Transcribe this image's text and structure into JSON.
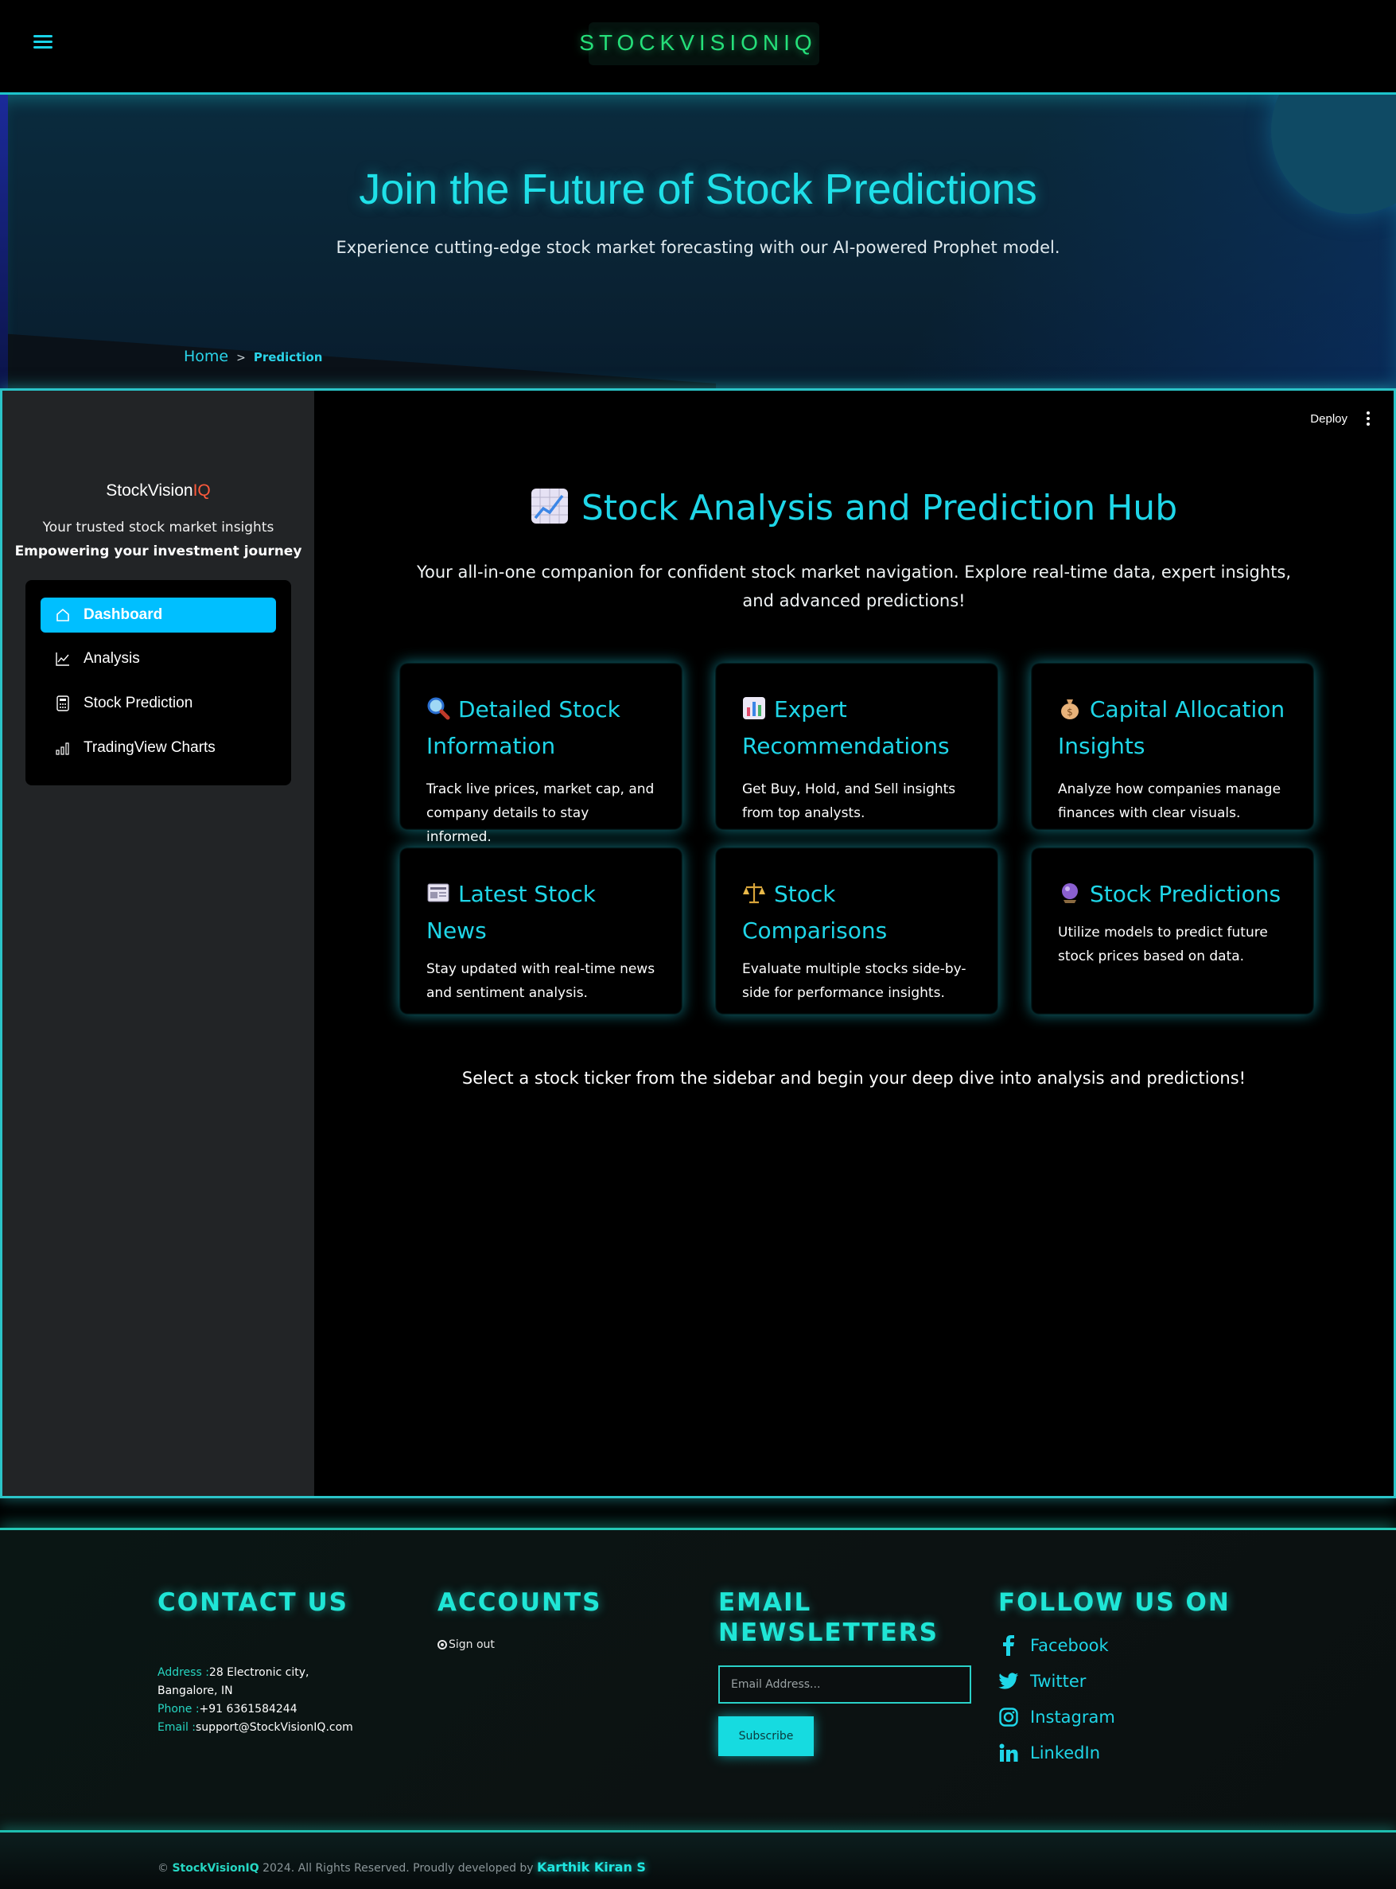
{
  "topbar": {
    "brand": "STOCKVISIONIQ"
  },
  "hero": {
    "title": "Join the Future of Stock Predictions",
    "subtitle": "Experience cutting-edge stock market forecasting with our AI-powered Prophet model.",
    "breadcrumb": {
      "home": "Home",
      "separator": ">",
      "current": "Prediction"
    }
  },
  "sidebar": {
    "brand_main": "StockVision",
    "brand_accent": "IQ",
    "tagline": "Your trusted stock market insights",
    "tagline_bold": "Empowering your investment journey",
    "items": [
      {
        "label": "Dashboard",
        "icon": "home-icon",
        "active": true
      },
      {
        "label": "Analysis",
        "icon": "line-chart-icon"
      },
      {
        "label": "Stock Prediction",
        "icon": "calculator-icon"
      },
      {
        "label": "TradingView Charts",
        "icon": "bar-signal-icon"
      }
    ]
  },
  "toolbar": {
    "deploy": "Deploy"
  },
  "main": {
    "title": "Stock Analysis and Prediction Hub",
    "intro": "Your all-in-one companion for confident stock market navigation. Explore real-time data, expert insights, and advanced predictions!",
    "cards": [
      {
        "title": "Detailed Stock Information",
        "desc": "Track live prices, market cap, and company details to stay informed.",
        "icon": "magnifier-icon"
      },
      {
        "title": "Expert Recommendations",
        "desc": "Get Buy, Hold, and Sell insights from top analysts.",
        "icon": "bar-chart-icon"
      },
      {
        "title": "Capital Allocation Insights",
        "desc": "Analyze how companies manage finances with clear visuals.",
        "icon": "money-bag-icon"
      },
      {
        "title": "Latest Stock News",
        "desc": "Stay updated with real-time news and sentiment analysis.",
        "icon": "newspaper-icon"
      },
      {
        "title": "Stock Comparisons",
        "desc": "Evaluate multiple stocks side-by-side for performance insights.",
        "icon": "scales-icon"
      },
      {
        "title": "Stock Predictions",
        "desc": "Utilize models to predict future stock prices based on data.",
        "icon": "crystal-ball-icon"
      }
    ],
    "cta": "Select a stock ticker from the sidebar and begin your deep dive into analysis and predictions!"
  },
  "footer": {
    "contact": {
      "heading": "CONTACT US",
      "address_label": "Address :",
      "address_line1": "28 Electronic city,",
      "address_line2": "Bangalore, IN",
      "phone_label": "Phone :",
      "phone": "+91 6361584244",
      "email_label": "Email :",
      "email": "support@StockVisionIQ.com"
    },
    "accounts": {
      "heading": "ACCOUNTS",
      "signout": "Sign out"
    },
    "newsletter": {
      "heading_line1": "EMAIL",
      "heading_line2": "NEWSLETTERS",
      "placeholder": "Email Address...",
      "button": "Subscribe"
    },
    "follow": {
      "heading": "FOLLOW US ON",
      "links": [
        {
          "label": "Facebook",
          "icon": "facebook-icon"
        },
        {
          "label": "Twitter",
          "icon": "twitter-icon"
        },
        {
          "label": "Instagram",
          "icon": "instagram-icon"
        },
        {
          "label": "LinkedIn",
          "icon": "linkedin-icon"
        }
      ]
    },
    "copyright": {
      "prefix": "© ",
      "brand": "StockVisionIQ",
      "text": " 2024. All Rights Reserved. Proudly developed by ",
      "developer": "Karthik Kiran S"
    }
  },
  "colors": {
    "accent": "#1fd6e8",
    "brand_green": "#25e07a",
    "active_nav": "#00bfff",
    "iq_red": "#ff5a3c"
  }
}
